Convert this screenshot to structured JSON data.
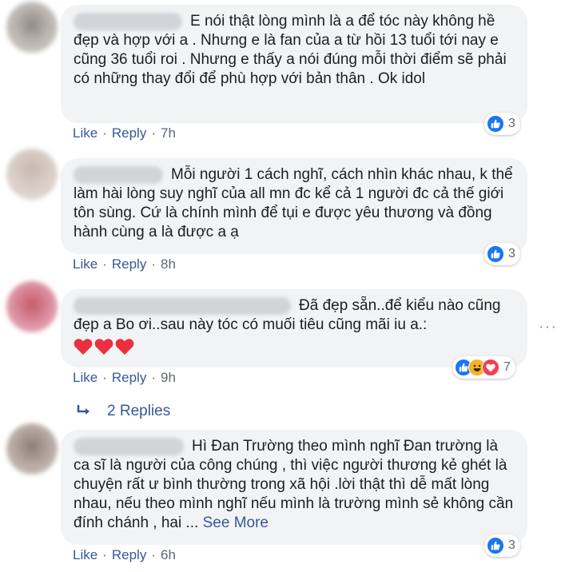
{
  "comments": [
    {
      "text": "E nói thật lòng mình là a để tóc này không hề đẹp và hợp với a . Nhưng e là fan của a từ hồi 13 tuổi tới nay e cũng 36 tuổi roi . Nhưng e thấy a nói đúng mỗi thời điểm sẽ phải có những thay đổi để phù hợp với bản thân . Ok idol",
      "like_label": "Like",
      "reply_label": "Reply",
      "time": "7h",
      "reaction_count": "3"
    },
    {
      "text": "Mỗi người 1 cách nghĩ, cách nhìn khác nhau, k thể làm hài lòng suy nghĩ của all mn đc kể cả 1 người đc cả thế giới tôn sùng. Cứ là chính mình để tụi e được yêu thương và đồng hành cùng a là được a ạ",
      "like_label": "Like",
      "reply_label": "Reply",
      "time": "8h",
      "reaction_count": "3"
    },
    {
      "text": "Đã đẹp sẵn..để kiểu nào cũng đẹp a Bo ơi..sau này tóc có muối tiêu cũng mãi iu a.:",
      "like_label": "Like",
      "reply_label": "Reply",
      "time": "9h",
      "reaction_count": "7",
      "replies_label": "2 Replies",
      "more_options": "···"
    },
    {
      "text": "Hì Đan Trường theo mình nghĩ Đan trường là ca sĩ là người của công chúng , thì việc người thương kẻ ghét là chuyện rất ư bình thường trong xã hội .lời thật thì dễ mất lòng nhau, nếu theo mình nghĩ nếu mình là trường mình sẻ không cần đính chánh , hai ...",
      "see_more": "See More",
      "like_label": "Like",
      "reply_label": "Reply",
      "time": "6h",
      "reaction_count": "3"
    }
  ],
  "icons": {
    "like_color": "#1877f2",
    "haha_color": "#f7b125",
    "love_color": "#f33e58",
    "link_color": "#385898"
  }
}
